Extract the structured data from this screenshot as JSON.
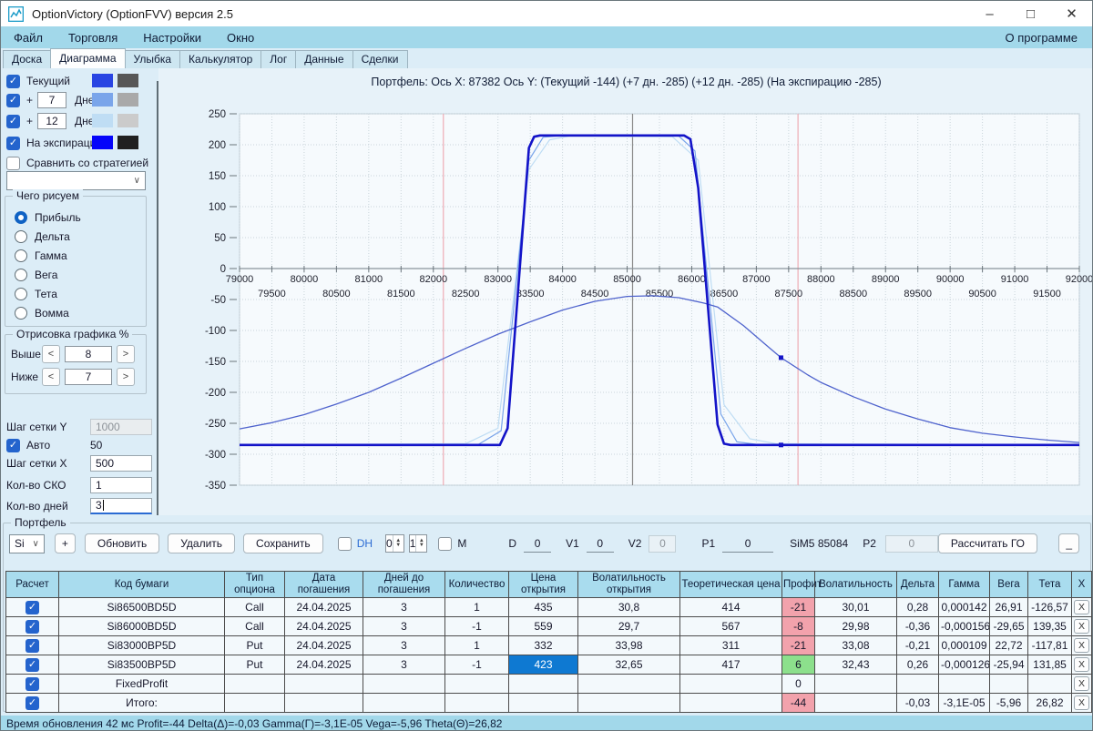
{
  "window": {
    "title": "OptionVictory (OptionFVV) версия 2.5",
    "controls": {
      "minimize": "–",
      "maximize": "□",
      "close": "✕"
    }
  },
  "menu": {
    "items": [
      "Файл",
      "Торговля",
      "Настройки",
      "Окно"
    ],
    "right": "О программе"
  },
  "tabs": {
    "items": [
      "Доска",
      "Диаграмма",
      "Улыбка",
      "Калькулятор",
      "Лог",
      "Данные",
      "Сделки"
    ],
    "active": "Диаграмма"
  },
  "left_panel": {
    "layers": [
      {
        "label": "Текущий",
        "checked": true,
        "swatch1": "#2945e3",
        "swatch2": "#575757"
      },
      {
        "label": "+",
        "value": "7",
        "suffix": "Дней",
        "checked": true,
        "swatch1": "#7aa5ea",
        "swatch2": "#a9a9a9"
      },
      {
        "label": "+",
        "value": "12",
        "suffix": "Дней",
        "checked": true,
        "swatch1": "#bfddf4",
        "swatch2": "#cbcbcb"
      },
      {
        "label": "На экспирацию",
        "checked": true,
        "swatch1": "#0505fa",
        "swatch2": "#202020"
      }
    ],
    "compare": {
      "label": "Сравнить со стратегией",
      "checked": false
    },
    "strategy_select_value": "",
    "draw_group": {
      "title": "Чего рисуем",
      "options": [
        "Прибыль",
        "Дельта",
        "Гамма",
        "Вега",
        "Тета",
        "Вомма"
      ],
      "selected": "Прибыль"
    },
    "range_group": {
      "title": "Отрисовка графика %",
      "rows": [
        {
          "label": "Выше",
          "value": "8"
        },
        {
          "label": "Ниже",
          "value": "7"
        }
      ],
      "dec_label": "<",
      "inc_label": ">"
    },
    "grid_y": {
      "label": "Шаг сетки Y",
      "value": "1000",
      "disabled": true
    },
    "auto": {
      "label": "Авто",
      "checked": true,
      "value": "50"
    },
    "grid_x": {
      "label": "Шаг сетки X",
      "value": "500"
    },
    "sko": {
      "label": "Кол-во СКО",
      "value": "1"
    },
    "days": {
      "label": "Кол-во дней",
      "value": "3"
    }
  },
  "chart_data": {
    "type": "line",
    "title": "Портфель:  Ось X: 87382 Ось Y:  (Текущий -144)  (+7 дн. -285)  (+12 дн. -285)  (На экспирацию -285)",
    "xlim": [
      79000,
      92000
    ],
    "ylim": [
      -350,
      250
    ],
    "x_major_step": 1000,
    "x_minor_step": 500,
    "y_step": 50,
    "grid": true,
    "price_line_x": 85084,
    "sko_lines_x": [
      82155,
      87645
    ],
    "crosshair_x": 87382,
    "markers": [
      {
        "x": 87382,
        "y": -144
      },
      {
        "x": 87382,
        "y": -285
      }
    ],
    "series": [
      {
        "name": "+12 дней",
        "color": "#bfddf4",
        "width": 1.2,
        "points": [
          [
            79000,
            -285
          ],
          [
            82500,
            -283
          ],
          [
            83000,
            -258
          ],
          [
            83480,
            160
          ],
          [
            83800,
            208
          ],
          [
            84100,
            214
          ],
          [
            85700,
            213
          ],
          [
            86100,
            175
          ],
          [
            86500,
            -220
          ],
          [
            86900,
            -275
          ],
          [
            87300,
            -283
          ],
          [
            92000,
            -285
          ]
        ]
      },
      {
        "name": "+7 дней",
        "color": "#7aa5ea",
        "width": 1.2,
        "points": [
          [
            79000,
            -285
          ],
          [
            82700,
            -284
          ],
          [
            83050,
            -262
          ],
          [
            83480,
            175
          ],
          [
            83700,
            212
          ],
          [
            84000,
            215
          ],
          [
            85800,
            214
          ],
          [
            86050,
            190
          ],
          [
            86450,
            -235
          ],
          [
            86700,
            -280
          ],
          [
            87000,
            -284
          ],
          [
            92000,
            -285
          ]
        ]
      },
      {
        "name": "Текущий",
        "color": "#4f63cd",
        "width": 1.3,
        "points": [
          [
            79000,
            -259
          ],
          [
            79500,
            -249
          ],
          [
            80000,
            -236
          ],
          [
            80500,
            -219
          ],
          [
            81000,
            -200
          ],
          [
            81500,
            -177
          ],
          [
            82000,
            -153
          ],
          [
            82500,
            -129
          ],
          [
            83000,
            -106
          ],
          [
            83500,
            -86
          ],
          [
            84000,
            -67
          ],
          [
            84500,
            -53
          ],
          [
            85000,
            -45
          ],
          [
            85400,
            -44
          ],
          [
            85800,
            -47
          ],
          [
            86200,
            -56
          ],
          [
            86400,
            -62
          ],
          [
            86800,
            -92
          ],
          [
            87200,
            -128
          ],
          [
            87382,
            -144
          ],
          [
            87800,
            -172
          ],
          [
            88000,
            -184
          ],
          [
            88500,
            -207
          ],
          [
            89000,
            -227
          ],
          [
            89500,
            -243
          ],
          [
            90000,
            -257
          ],
          [
            90500,
            -266
          ],
          [
            91000,
            -272
          ],
          [
            91500,
            -277
          ],
          [
            92000,
            -281
          ]
        ]
      },
      {
        "name": "На экспирацию",
        "color": "#1313c8",
        "width": 2.6,
        "points": [
          [
            79000,
            -285
          ],
          [
            83030,
            -285
          ],
          [
            83150,
            -258
          ],
          [
            83480,
            195
          ],
          [
            83560,
            213
          ],
          [
            83650,
            215
          ],
          [
            85880,
            215
          ],
          [
            85980,
            209
          ],
          [
            86100,
            130
          ],
          [
            86400,
            -252
          ],
          [
            86500,
            -283
          ],
          [
            86600,
            -285
          ],
          [
            92000,
            -285
          ]
        ]
      }
    ],
    "colors": {
      "grid": "#c9d4da",
      "axis": "#8a949c",
      "sko_line": "#eeacb4",
      "price_line": "#8a8a8a",
      "marker": "#1515c8",
      "plot_bg": "#f6fafd"
    }
  },
  "toolbar": {
    "group_label": "Портфель",
    "portfolio_select": "Si",
    "add_button": "+",
    "buttons": [
      "Обновить",
      "Удалить",
      "Сохранить"
    ],
    "dh": {
      "label": "DH",
      "checked": false
    },
    "spin1": "0",
    "spin2": "1",
    "m": {
      "label": "M",
      "checked": false
    },
    "fields": [
      {
        "label": "D",
        "value": "0",
        "disabled": false
      },
      {
        "label": "V1",
        "value": "0",
        "disabled": false
      },
      {
        "label": "V2",
        "value": "0",
        "disabled": true
      },
      {
        "label": "P1",
        "value": "0",
        "disabled": false
      }
    ],
    "instrument": "SiM5 85084",
    "p2": {
      "label": "P2",
      "value": "0",
      "disabled": true
    },
    "calc_button": "Рассчитать ГО",
    "collapse_button": "_"
  },
  "table": {
    "headers": [
      "Расчет",
      "Код бумаги",
      "Тип опциона",
      "Дата погашения",
      "Дней до погашения",
      "Количество",
      "Цена открытия",
      "Волатильность открытия",
      "Теоретическая цена",
      "Профит",
      "Волатильность",
      "Дельта",
      "Гамма",
      "Вега",
      "Тета",
      "X"
    ],
    "delete_label": "X",
    "rows": [
      {
        "checked": true,
        "code": "Si86500BD5D",
        "type": "Call",
        "date": "24.04.2025",
        "days": "3",
        "qty": "1",
        "open_price": "435",
        "open_vol": "30,8",
        "theo": "414",
        "profit": "-21",
        "profit_state": "neg",
        "vol": "30,01",
        "delta": "0,28",
        "gamma": "0,000142",
        "vega": "26,91",
        "theta": "-126,57"
      },
      {
        "checked": true,
        "code": "Si86000BD5D",
        "type": "Call",
        "date": "24.04.2025",
        "days": "3",
        "qty": "-1",
        "open_price": "559",
        "open_vol": "29,7",
        "theo": "567",
        "profit": "-8",
        "profit_state": "neg",
        "vol": "29,98",
        "delta": "-0,36",
        "gamma": "-0,000156",
        "vega": "-29,65",
        "theta": "139,35"
      },
      {
        "checked": true,
        "code": "Si83000BP5D",
        "type": "Put",
        "date": "24.04.2025",
        "days": "3",
        "qty": "1",
        "open_price": "332",
        "open_vol": "33,98",
        "theo": "311",
        "profit": "-21",
        "profit_state": "neg",
        "vol": "33,08",
        "delta": "-0,21",
        "gamma": "0,000109",
        "vega": "22,72",
        "theta": "-117,81"
      },
      {
        "checked": true,
        "code": "Si83500BP5D",
        "type": "Put",
        "date": "24.04.2025",
        "days": "3",
        "qty": "-1",
        "open_price": "423",
        "open_price_selected": true,
        "open_vol": "32,65",
        "theo": "417",
        "profit": "6",
        "profit_state": "pos",
        "vol": "32,43",
        "delta": "0,26",
        "gamma": "-0,000126",
        "vega": "-25,94",
        "theta": "131,85"
      },
      {
        "checked": true,
        "code": "FixedProfit",
        "type": "",
        "date": "",
        "days": "",
        "qty": "",
        "open_price": "",
        "open_vol": "",
        "theo": "",
        "profit": "0",
        "profit_state": "zero",
        "vol": "",
        "delta": "",
        "gamma": "",
        "vega": "",
        "theta": ""
      },
      {
        "checked": true,
        "code": "Итого:",
        "type": "",
        "date": "",
        "days": "",
        "qty": "",
        "open_price": "",
        "open_vol": "",
        "theo": "",
        "profit": "-44",
        "profit_state": "neg",
        "vol": "",
        "delta": "-0,03",
        "gamma": "-3,1E-05",
        "vega": "-5,96",
        "theta": "26,82"
      }
    ]
  },
  "status_bar": {
    "text": "Время обновления 42 мс  Profit=-44 Delta(Δ)=-0,03 Gamma(Γ)=-3,1E-05 Vega=-5,96 Theta(Θ)=26,82"
  }
}
